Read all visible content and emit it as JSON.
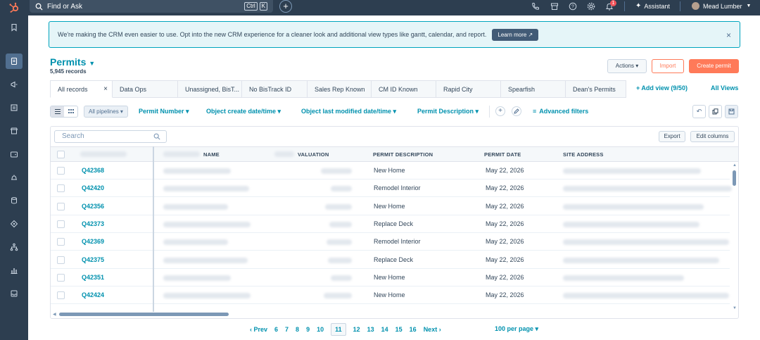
{
  "topbar": {
    "search_placeholder": "Find or Ask",
    "shortcut_key1": "Ctrl",
    "shortcut_key2": "K",
    "add_label": "+",
    "notification_count": "1",
    "assistant_label": "Assistant",
    "user_name": "Mead Lumber"
  },
  "banner": {
    "text": "We're making the CRM even easier to use. Opt into the new CRM experience for a cleaner look and additional view types like gantt, calendar, and report.",
    "learn_more": "Learn more ↗",
    "close": "×"
  },
  "header": {
    "title": "Permits",
    "record_count": "5,945 records",
    "actions_label": "Actions ▾",
    "import_label": "Import",
    "create_label": "Create permit"
  },
  "tabs": [
    {
      "label": "All records"
    },
    {
      "label": "Data Ops"
    },
    {
      "label": "Unassigned, BisT..."
    },
    {
      "label": "No BisTrack ID"
    },
    {
      "label": "Sales Rep Known"
    },
    {
      "label": "CM ID Known"
    },
    {
      "label": "Rapid City"
    },
    {
      "label": "Spearfish"
    },
    {
      "label": "Dean's Permits"
    }
  ],
  "tab_close": "×",
  "add_view_label": "+ Add view (9/50)",
  "all_views_label": "All Views",
  "filters": {
    "pipelines": "All pipelines ▾",
    "permit_number": "Permit Number ▾",
    "create_date": "Object create date/time ▾",
    "modified_date": "Object last modified date/time ▾",
    "permit_description": "Permit Description ▾",
    "advanced": "Advanced filters"
  },
  "table": {
    "search_placeholder": "Search",
    "export_label": "Export",
    "edit_columns_label": "Edit columns",
    "columns": {
      "name": "NAME",
      "valuation": "VALUATION",
      "permit_description": "PERMIT DESCRIPTION",
      "permit_date": "PERMIT DATE",
      "site_address": "SITE ADDRESS"
    },
    "rows": [
      {
        "id": "Q42368",
        "description": "New Home",
        "date": "May 22, 2026"
      },
      {
        "id": "Q42420",
        "description": "Remodel Interior",
        "date": "May 22, 2026"
      },
      {
        "id": "Q42356",
        "description": "New Home",
        "date": "May 22, 2026"
      },
      {
        "id": "Q42373",
        "description": "Replace Deck",
        "date": "May 22, 2026"
      },
      {
        "id": "Q42369",
        "description": "Remodel Interior",
        "date": "May 22, 2026"
      },
      {
        "id": "Q42375",
        "description": "Replace Deck",
        "date": "May 22, 2026"
      },
      {
        "id": "Q42351",
        "description": "New Home",
        "date": "May 22, 2026"
      },
      {
        "id": "Q42424",
        "description": "New Home",
        "date": "May 22, 2026"
      }
    ]
  },
  "pagination": {
    "prev": "‹  Prev",
    "pages": [
      "6",
      "7",
      "8",
      "9",
      "10",
      "11",
      "12",
      "13",
      "14",
      "15",
      "16"
    ],
    "current": "11",
    "next": "Next  ›",
    "per_page": "100 per page ▾"
  },
  "colors": {
    "accent": "#0091ae",
    "primary_button": "#ff7a59",
    "nav_bg": "#2d3e50"
  }
}
